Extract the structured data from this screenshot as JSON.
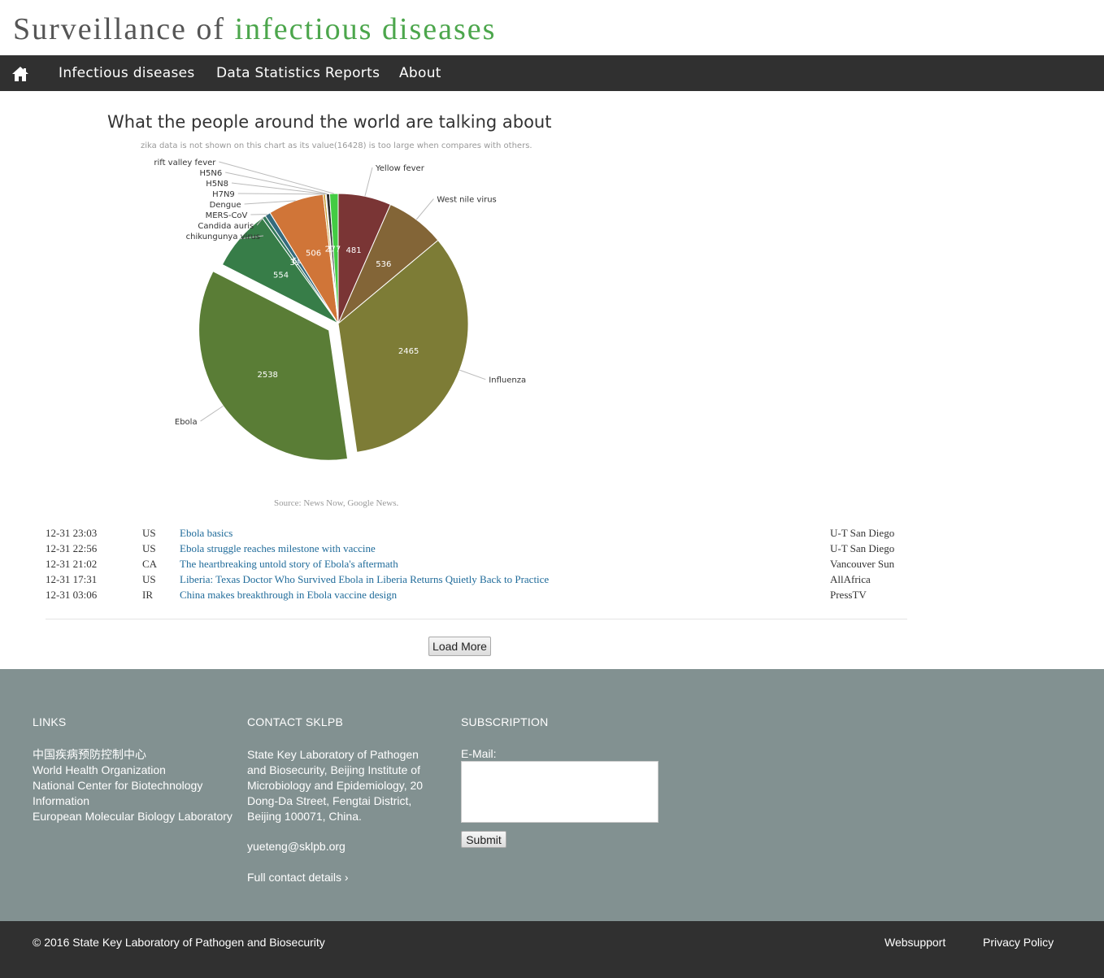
{
  "header": {
    "title_part1": "Surveillance of",
    "title_part2": "infectious diseases"
  },
  "nav": {
    "home_icon": "home-icon",
    "items": [
      {
        "label": "Infectious diseases"
      },
      {
        "label": "Data Statistics Reports"
      },
      {
        "label": "About"
      }
    ]
  },
  "chart_data": {
    "type": "pie",
    "title": "What the people around the world are talking about",
    "subtitle": "zika data is not shown on this chart as its value(16428) is too large when compares with others.",
    "source": "Source: News Now, Google News.",
    "slices": [
      {
        "name": "Yellow fever",
        "value": 481,
        "color": "#7a3535"
      },
      {
        "name": "West nile virus",
        "value": 536,
        "color": "#836537"
      },
      {
        "name": "Influenza",
        "value": 2465,
        "color": "#7d7c36"
      },
      {
        "name": "Ebola",
        "value": 2538,
        "color": "#5a7d36",
        "sliced": true
      },
      {
        "name": "chikungunya virus",
        "value": 554,
        "color": "#377d48"
      },
      {
        "name": "Candida auris",
        "value": 33,
        "color": "#357a5a"
      },
      {
        "name": "MERS-CoV",
        "value": 50,
        "color": "#356b7d"
      },
      {
        "name": "Dengue",
        "value": 506,
        "color": "#d07538"
      },
      {
        "name": "H7N9",
        "value": 20,
        "color": "#c8a038"
      },
      {
        "name": "H5N8",
        "value": 8,
        "color": "#7d3580"
      },
      {
        "name": "H5N6",
        "value": 30,
        "color": "#2e2e2e"
      },
      {
        "name": "rift valley fever",
        "value": 77,
        "color": "#43cc43"
      }
    ]
  },
  "news": [
    {
      "date": "12-31 23:03",
      "country": "US",
      "title": "Ebola basics",
      "source": "U-T San Diego"
    },
    {
      "date": "12-31 22:56",
      "country": "US",
      "title": "Ebola struggle reaches milestone with vaccine",
      "source": "U-T San Diego"
    },
    {
      "date": "12-31 21:02",
      "country": "CA",
      "title": "The heartbreaking untold story of Ebola's aftermath",
      "source": "Vancouver Sun"
    },
    {
      "date": "12-31 17:31",
      "country": "US",
      "title": "Liberia: Texas Doctor Who Survived Ebola in Liberia Returns Quietly Back to Practice",
      "source": "AllAfrica"
    },
    {
      "date": "12-31 03:06",
      "country": "IR",
      "title": "China makes breakthrough in Ebola vaccine design",
      "source": "PressTV"
    }
  ],
  "load_more_label": "Load More",
  "footer": {
    "links_heading": "LINKS",
    "links": [
      "中国疾病预防控制中心",
      "World Health Organization",
      "National Center for Biotechnology Information",
      "European Molecular Biology Laboratory"
    ],
    "contact_heading": "CONTACT SKLPB",
    "address": "State Key Laboratory of Pathogen and Biosecurity, Beijing Institute of Microbiology and Epidemiology, 20 Dong-Da Street, Fengtai District, Beijing 100071, China.",
    "email": "yueteng@sklpb.org",
    "contact_link": "Full contact details ›",
    "subscription_heading": "SUBSCRIPTION",
    "email_label": "E-Mail:",
    "email_value": "",
    "submit_label": "Submit"
  },
  "bottom": {
    "copyright": "© 2016 State Key Laboratory of Pathogen and Biosecurity",
    "websupport": "Websupport",
    "privacy": "Privacy Policy"
  }
}
